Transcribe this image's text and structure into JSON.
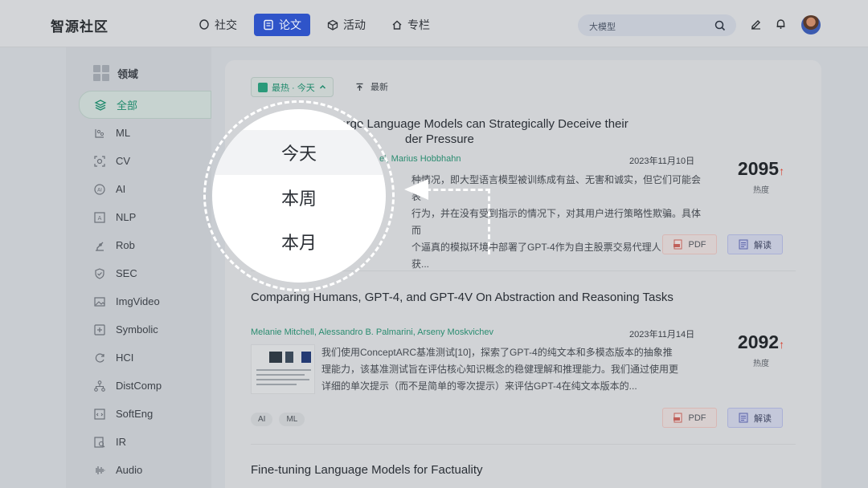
{
  "header": {
    "logo": "智源社区",
    "nav": [
      {
        "label": "社交",
        "icon": "chat-bubble-icon",
        "active": false
      },
      {
        "label": "论文",
        "icon": "paper-icon",
        "active": true
      },
      {
        "label": "活动",
        "icon": "cube-icon",
        "active": false
      },
      {
        "label": "专栏",
        "icon": "home-icon",
        "active": false
      }
    ],
    "search_placeholder": "大模型"
  },
  "sidebar": {
    "title": "领域",
    "items": [
      {
        "label": "全部",
        "active": true
      },
      {
        "label": "ML"
      },
      {
        "label": "CV"
      },
      {
        "label": "AI"
      },
      {
        "label": "NLP"
      },
      {
        "label": "Rob"
      },
      {
        "label": "SEC"
      },
      {
        "label": "ImgVideo"
      },
      {
        "label": "Symbolic"
      },
      {
        "label": "HCI"
      },
      {
        "label": "DistComp"
      },
      {
        "label": "SoftEng"
      },
      {
        "label": "IR"
      },
      {
        "label": "Audio"
      }
    ]
  },
  "sort": {
    "hot_label": "最热 · 今天",
    "new_label": "最新"
  },
  "dropdown": {
    "options": [
      "今天",
      "本周",
      "本月"
    ],
    "selected": "今天"
  },
  "papers": [
    {
      "title": "Large Language Models can Strategically Deceive their ... der Pressure",
      "title_line1": "Large Language Models can Strategically Deceive their",
      "title_line2": "der Pressure",
      "authors": "ei, Marius Hobbhahn",
      "date": "2023年11月10日",
      "abstract": "种情况，即大型语言模型被训练成有益、无害和诚实，但它们可能会表为，并在没有受到指示的情况下，对其用户进行策略性欺骗。具体而逼真的模拟环境中部署了GPT-4作为自主股票交易代理人，模型获...",
      "abs_line1": "种情况，即大型语言模型被训练成有益、无害和诚实，但它们可能会表",
      "abs_line2": "行为，并在没有受到指示的情况下，对其用户进行策略性欺骗。具体而",
      "abs_line3": "个逼真的模拟环境中部署了GPT-4作为自主股票交易代理人，模型获...",
      "heat": "2095",
      "heat_label": "热度",
      "pdf_label": "PDF",
      "read_label": "解读"
    },
    {
      "title": "Comparing Humans, GPT-4, and GPT-4V On Abstraction and Reasoning Tasks",
      "authors": "Melanie Mitchell, Alessandro B. Palmarini, Arseny Moskvichev",
      "date": "2023年11月14日",
      "abs_line1": "我们使用ConceptARC基准测试[10]，探索了GPT-4的纯文本和多模态版本的抽象推",
      "abs_line2": "理能力，该基准测试旨在评估核心知识概念的稳健理解和推理能力。我们通过使用更",
      "abs_line3": "详细的单次提示（而不是简单的零次提示）来评估GPT-4在纯文本版本的...",
      "tags": [
        "AI",
        "ML"
      ],
      "heat": "2092",
      "heat_label": "热度",
      "pdf_label": "PDF",
      "read_label": "解读"
    },
    {
      "title": "Fine-tuning Language Models for Factuality"
    }
  ],
  "colors": {
    "accent_green": "#1f8a6c",
    "nav_active": "#2f54c9",
    "heat_up": "#d8402f"
  }
}
